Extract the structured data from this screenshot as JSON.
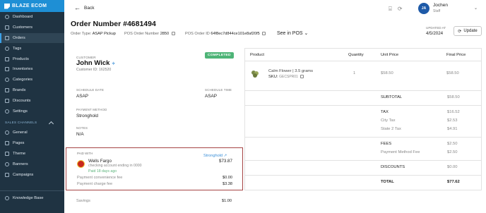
{
  "app": {
    "brand": "BLAZE ECOM"
  },
  "sidebar": {
    "items": [
      {
        "label": "Dashboard",
        "icon": "dashboard-icon",
        "active": false
      },
      {
        "label": "Customers",
        "icon": "customers-icon",
        "active": false
      },
      {
        "label": "Orders",
        "icon": "orders-icon",
        "active": true
      },
      {
        "label": "Tags",
        "icon": "tag-icon",
        "active": false
      },
      {
        "label": "Products",
        "icon": "products-icon",
        "active": false
      },
      {
        "label": "Inventories",
        "icon": "inventories-icon",
        "active": false
      },
      {
        "label": "Categories",
        "icon": "categories-icon",
        "active": false
      },
      {
        "label": "Brands",
        "icon": "brands-icon",
        "active": false
      },
      {
        "label": "Discounts",
        "icon": "discounts-icon",
        "active": false
      },
      {
        "label": "Settings",
        "icon": "gear-icon",
        "active": false
      }
    ],
    "section_label": "SALES CHANNELS",
    "channel_items": [
      {
        "label": "General",
        "icon": "general-icon"
      },
      {
        "label": "Pages",
        "icon": "pages-icon"
      },
      {
        "label": "Theme",
        "icon": "theme-icon"
      },
      {
        "label": "Banners",
        "icon": "banners-icon"
      },
      {
        "label": "Campaigns",
        "icon": "campaigns-icon"
      }
    ],
    "knowledge_base": "Knowledge Base"
  },
  "topbar": {
    "back_label": "Back",
    "user_initials": "JA",
    "user_name": "Jochen",
    "user_role": "Staff"
  },
  "order": {
    "title": "Order Number #4681494",
    "type_label": "Order Type:",
    "type_value": "ASAP Pickup",
    "pos_number_label": "POS Order Number",
    "pos_number_value": "2850",
    "pos_id_label": "POS Order ID",
    "pos_id_value": "64f8ec7d844ce101e8af20f5",
    "see_in_pos": "See in POS",
    "updated_label": "UPDATED AT",
    "updated_date": "4/5/2024",
    "update_button": "Update"
  },
  "customer": {
    "label": "CUSTOMER",
    "name": "John Wick",
    "id_text": "Customer ID: 162520",
    "status": "COMPLETED",
    "schedule_date_label": "SCHEDULE DATE",
    "schedule_date_value": "ASAP",
    "schedule_time_label": "SCHEDULE TIME",
    "schedule_time_value": "ASAP",
    "payment_method_label": "PAYMENT METHOD",
    "payment_method_value": "Stronghold",
    "notes_label": "NOTES",
    "notes_value": "N/A"
  },
  "payment": {
    "label": "PAID WITH",
    "provider_link": "Stronghold",
    "bank": "Wells Fargo",
    "account": "checking account ending in 0000",
    "paid_when": "Paid 18 days ago",
    "amount": "$73.87",
    "fees": [
      {
        "label": "Payment convenience fee",
        "value": "$0.00"
      },
      {
        "label": "Payment charge fee",
        "value": "$3.38"
      },
      {
        "label": "Savings",
        "value": "$1.00"
      }
    ]
  },
  "table": {
    "headers": {
      "product": "Product",
      "quantity": "Quantity",
      "unit_price": "Unit Price",
      "final_price": "Final Price"
    },
    "product": {
      "name": "Calm Flower | 3.5 grams",
      "sku_label": "SKU:",
      "sku_value": "GECSPR01",
      "quantity": "1",
      "unit_price": "$58.50",
      "final_price": "$58.50"
    },
    "subtotal": {
      "label": "SUBTOTAL",
      "value": "$58.50"
    },
    "tax": {
      "label": "TAX",
      "value": "$16.52"
    },
    "city_tax": {
      "label": "City Tax",
      "value": "$2.53"
    },
    "state_tax": {
      "label": "State 2 Tax",
      "value": "$4.91"
    },
    "fees": {
      "label": "FEES",
      "value": "$2.50"
    },
    "payment_method_fee": {
      "label": "Payment Method Fee",
      "value": "$2.50"
    },
    "discounts": {
      "label": "DISCOUNTS",
      "value": "$0.00"
    },
    "total": {
      "label": "TOTAL",
      "value": "$77.62"
    }
  }
}
